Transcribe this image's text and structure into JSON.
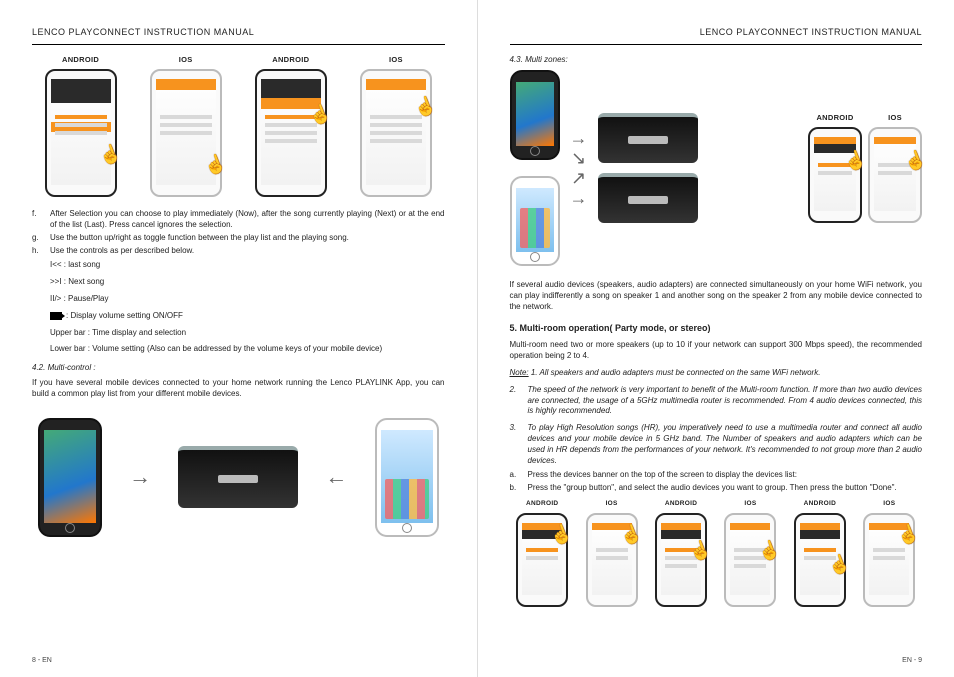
{
  "header": "LENCO PLAYCONNECT INSTRUCTION MANUAL",
  "os": {
    "android": "ANDROID",
    "ios": "IOS"
  },
  "left": {
    "f": "After Selection you can choose to play immediately (Now), after the song currently playing (Next) or at the end of the list (Last). Press cancel ignores the selection.",
    "g": "Use the button up/right as toggle function between the play list and the playing song.",
    "h": "Use the controls as per described below.",
    "ctrl_last": "I<< : last song",
    "ctrl_next": ">>I : Next song",
    "ctrl_pause": "II/> : Pause/Play",
    "ctrl_vol": ": Display volume setting ON/OFF",
    "ctrl_upper": "Upper bar : Time display and selection",
    "ctrl_lower": "Lower bar : Volume setting (Also can be addressed by the volume keys of your mobile device)",
    "sub42": "4.2. Multi-control :",
    "mc_para": "If you have several mobile devices connected to your home network running the Lenco PLAYLINK App, you can build a common play list from your different mobile devices.",
    "pagenum": "8  - EN"
  },
  "right": {
    "sub43": "4.3. Multi zones:",
    "mz_para": "If several audio devices (speakers, audio adapters) are connected simultaneously on your home WiFi network, you can play indifferently a song on speaker 1 and another song on the speaker 2 from any mobile device connected to the network.",
    "sec5": "5. Multi-room operation( Party mode, or stereo)",
    "mr_para": "Multi-room need two or more speakers (up to 10 if your network can support 300 Mbps speed), the recommended operation being 2 to 4.",
    "note_lead": "Note:",
    "note1": "1. All speakers and audio adapters must be connected on the same WiFi network.",
    "note2": "The speed of the network is very important to benefit of the Multi-room function. If more than two audio devices are connected, the usage of a 5GHz multimedia router is recommended. From 4 audio devices connected, this is highly recommended.",
    "note3": "To play High Resolution songs (HR), you imperatively need to use a multimedia router and connect all audio devices and your mobile device in 5 GHz band. The Number of speakers and audio adapters which can be used in HR depends from the performances of your network. It's recommended to not group more than 2 audio devices.",
    "step_a": "Press the devices banner on the top of the screen to display the devices list:",
    "step_b": "Press the \"group button\", and select the audio devices you want to group. Then press the button \"Done\".",
    "pagenum": "EN -  9"
  }
}
